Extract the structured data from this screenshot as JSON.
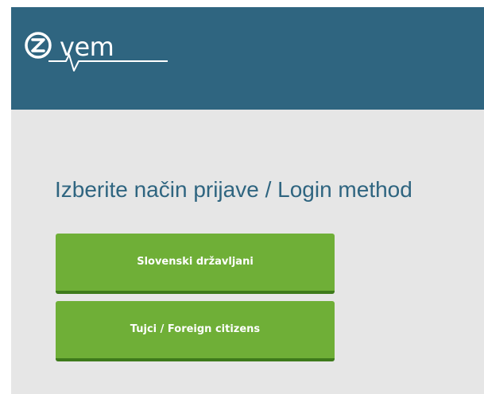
{
  "header": {
    "logo_text": "vem",
    "logo_letter": "z"
  },
  "main": {
    "title": "Izberite način prijave / Login method",
    "buttons": [
      {
        "label": "Slovenski državljani"
      },
      {
        "label": "Tujci / Foreign citizens"
      }
    ]
  },
  "colors": {
    "header_bg": "#2f6580",
    "page_bg": "#e6e6e6",
    "button_bg": "#6faf37",
    "button_border": "#3e7a1b",
    "title_color": "#2f6580"
  }
}
